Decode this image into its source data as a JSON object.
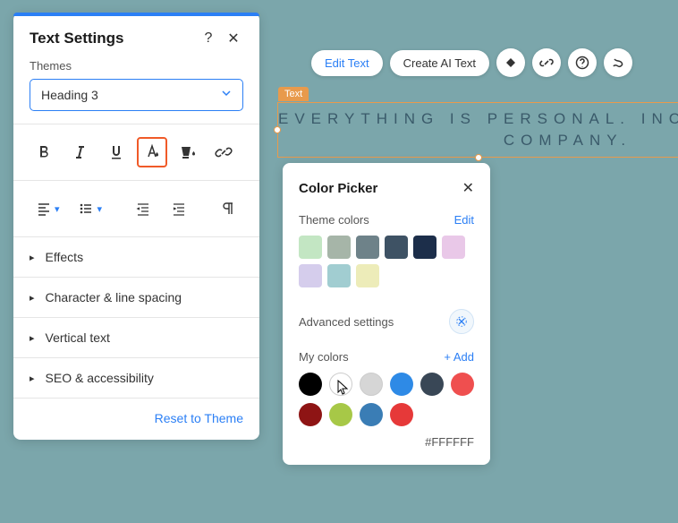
{
  "settings": {
    "title": "Text Settings",
    "themes_label": "Themes",
    "theme_selected": "Heading 3",
    "collapsibles": [
      "Effects",
      "Character & line spacing",
      "Vertical text",
      "SEO & accessibility"
    ],
    "reset_label": "Reset to Theme"
  },
  "toolbar": {
    "edit_text": "Edit Text",
    "create_ai": "Create AI Text"
  },
  "text_element": {
    "tag": "Text",
    "line1": "EVERYTHING IS PERSONAL. INCLUD",
    "line2": "COMPANY."
  },
  "picker": {
    "title": "Color Picker",
    "theme_colors_label": "Theme colors",
    "edit_label": "Edit",
    "theme_swatches": [
      "#c3e6c3",
      "#a6b5a8",
      "#6e8289",
      "#3e5264",
      "#1c2e4a",
      "#e9c8e8",
      "#d5cdec",
      "#a1cdd1",
      "#edecb9"
    ],
    "advanced_label": "Advanced settings",
    "my_colors_label": "My colors",
    "add_label": "+ Add",
    "my_colors": [
      "#000000",
      "#ffffff",
      "#d6d6d6",
      "#2e8ae6",
      "#394756",
      "#ef4f4f",
      "#8e1414",
      "#a7c847",
      "#3a7db5",
      "#e63939"
    ],
    "hex": "#FFFFFF"
  }
}
